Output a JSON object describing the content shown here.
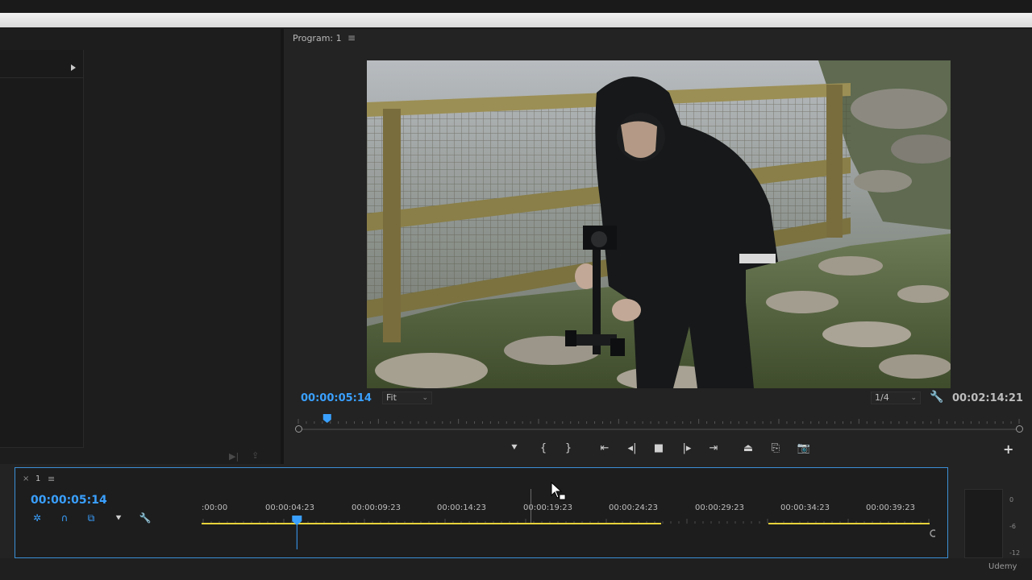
{
  "program_monitor": {
    "tab_label": "Program: 1",
    "current_timecode": "00:00:05:14",
    "duration_timecode": "00:02:14:21",
    "zoom_value": "Fit",
    "resolution_value": "1/4",
    "playhead_fraction": 0.04
  },
  "timeline": {
    "sequence_label": "1",
    "current_timecode": "00:00:05:14",
    "ruler_labels": [
      ":00:00",
      "00:00:04:23",
      "00:00:09:23",
      "00:00:14:23",
      "00:00:19:23",
      "00:00:24:23",
      "00:00:29:23",
      "00:00:34:23",
      "00:00:39:23"
    ],
    "playhead_fraction": 0.13
  },
  "meter": {
    "scale": [
      "0",
      "-6",
      "-12"
    ]
  },
  "watermark": "Udemy",
  "colors": {
    "accent_blue": "#3aa0ff",
    "work_area_yellow": "#e8d23a",
    "panel_border": "#3b8fd6"
  },
  "icons": {
    "transport": [
      "marker-icon",
      "mark-in-icon",
      "mark-out-icon",
      "go-to-in-icon",
      "step-back-icon",
      "stop-icon",
      "step-forward-icon",
      "go-to-out-icon",
      "lift-icon",
      "extract-icon",
      "export-frame-icon"
    ],
    "timeline_tools": [
      "snap-icon",
      "linked-selection-icon",
      "insert-overwrite-icon",
      "add-marker-icon",
      "settings-wrench-icon"
    ]
  }
}
